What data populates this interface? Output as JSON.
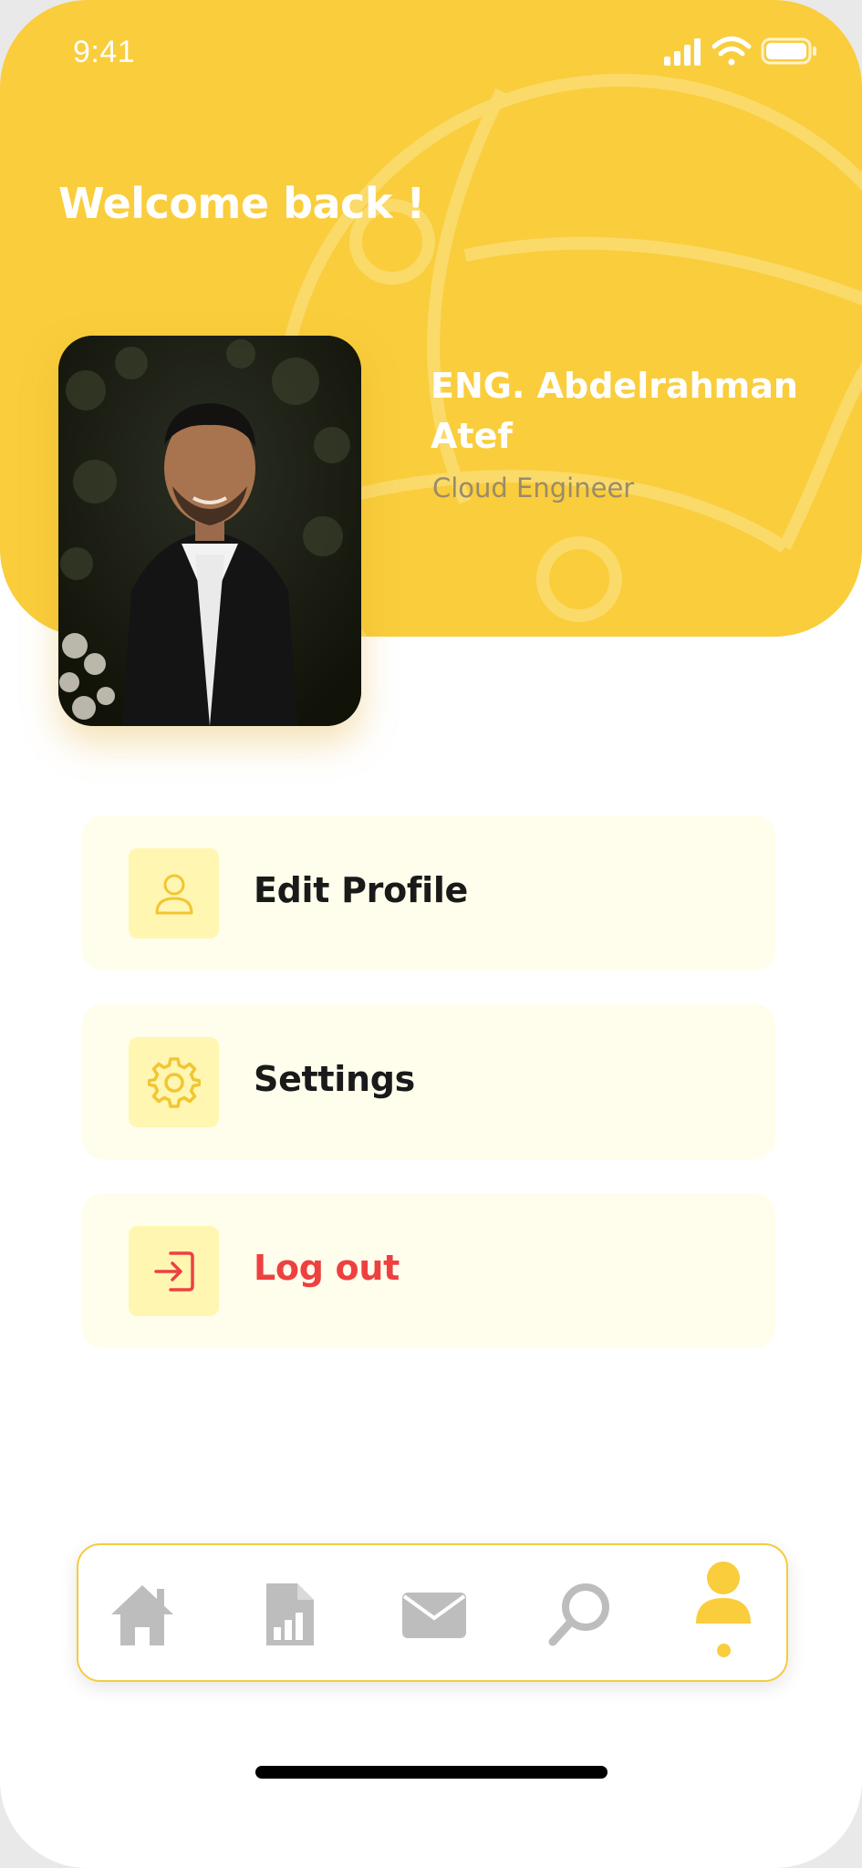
{
  "status_bar": {
    "time": "9:41",
    "icons": [
      "signal-icon",
      "wifi-icon",
      "battery-icon"
    ]
  },
  "header": {
    "welcome": "Welcome back !",
    "accent_color": "#f9cd3c"
  },
  "profile": {
    "name": "ENG. Abdelrahman Atef",
    "role": "Cloud Engineer",
    "photo_alt": "profile photo"
  },
  "menu": [
    {
      "label": "Edit Profile",
      "icon": "user-icon",
      "color": "#1a1a1a"
    },
    {
      "label": "Settings",
      "icon": "gear-icon",
      "color": "#1a1a1a"
    },
    {
      "label": "Log out",
      "icon": "logout-icon",
      "color": "#ee4040"
    }
  ],
  "bottom_nav": {
    "items": [
      {
        "name": "home",
        "icon": "home-icon",
        "active": false
      },
      {
        "name": "reports",
        "icon": "report-icon",
        "active": false
      },
      {
        "name": "messages",
        "icon": "mail-icon",
        "active": false
      },
      {
        "name": "search",
        "icon": "search-icon",
        "active": false
      },
      {
        "name": "profile",
        "icon": "profile-icon",
        "active": true
      }
    ],
    "inactive_color": "#bdbdbd",
    "active_color": "#f9cd3c"
  }
}
